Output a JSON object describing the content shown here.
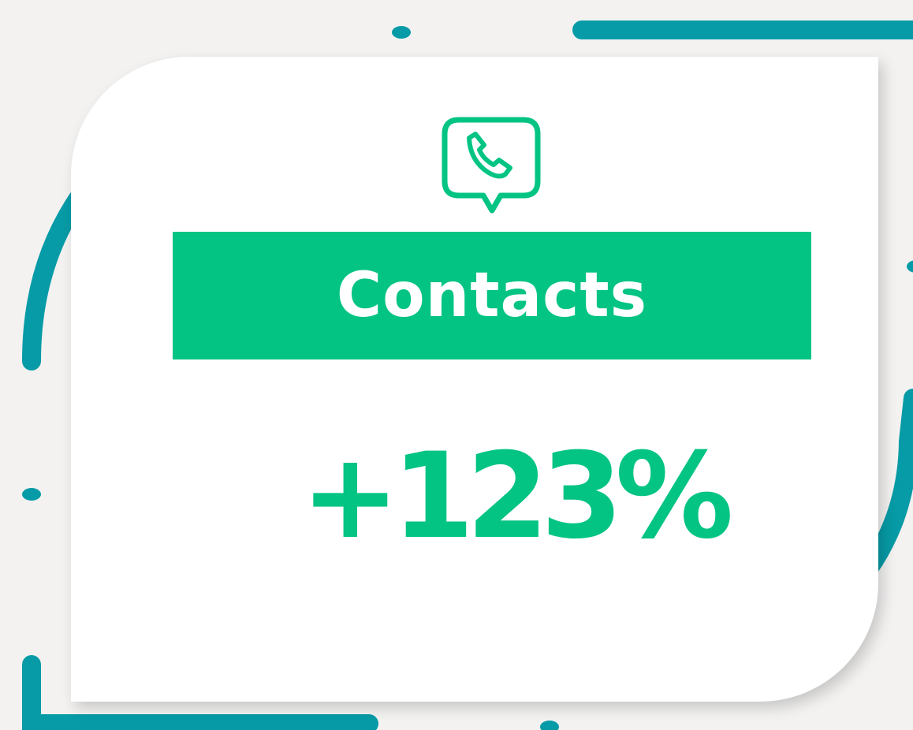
{
  "card": {
    "title": "Contacts",
    "value": "+123%",
    "icon": "phone-chat-icon"
  },
  "colors": {
    "background": "#f3f2f1",
    "card": "#ffffff",
    "accent_green": "#03c483",
    "decor_teal": "#069ba6"
  }
}
